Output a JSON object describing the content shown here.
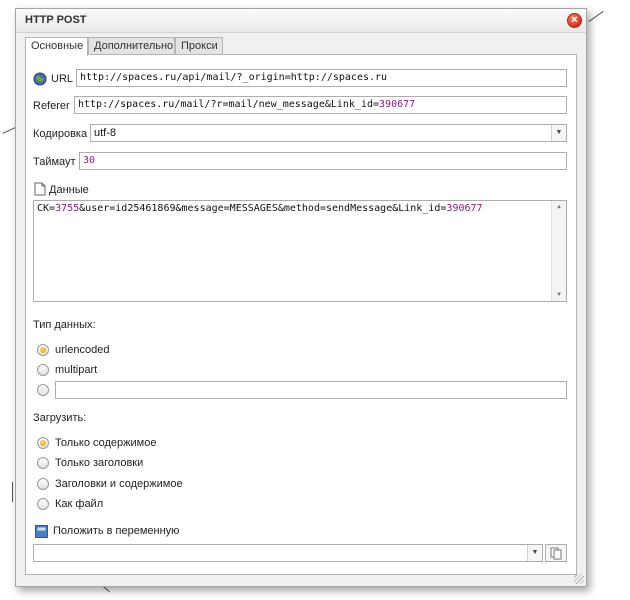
{
  "window": {
    "title": "HTTP POST",
    "close_glyph": "×"
  },
  "tabs": [
    {
      "label": "Основные",
      "active": true
    },
    {
      "label": "Дополнительно",
      "active": false
    },
    {
      "label": "Прокси",
      "active": false
    }
  ],
  "fields": {
    "url": {
      "label": "URL",
      "value": "http://spaces.ru/api/mail/?_origin=http://spaces.ru"
    },
    "referer": {
      "label": "Referer",
      "value_text": "http://spaces.ru/mail/?r=mail/new_message&Link_id=",
      "value_num": "390677"
    },
    "encoding": {
      "label": "Кодировка",
      "value": "utf-8"
    },
    "timeout": {
      "label": "Таймаут",
      "value": "30"
    },
    "data": {
      "label": "Данные",
      "value_parts": [
        "CK=",
        "3755",
        "&user=id25461869&message=MESSAGES&method=sendMessage&Link_id=",
        "390677"
      ]
    }
  },
  "data_type": {
    "label": "Тип данных:",
    "options": [
      {
        "label": "urlencoded",
        "checked": true
      },
      {
        "label": "multipart",
        "checked": false
      },
      {
        "label": "",
        "checked": false,
        "has_input": true,
        "input_value": ""
      }
    ]
  },
  "load": {
    "label": "Загрузить:",
    "options": [
      {
        "label": "Только содержимое",
        "checked": true
      },
      {
        "label": "Только заголовки",
        "checked": false
      },
      {
        "label": "Заголовки и содержимое",
        "checked": false
      },
      {
        "label": "Как файл",
        "checked": false
      }
    ]
  },
  "save_to_var": {
    "label": "Положить в переменную",
    "value": ""
  },
  "icons": {
    "url": "globe-icon",
    "data": "document-icon",
    "save": "variable-icon",
    "copy": "copy-icon",
    "dropdown": "chevron-down-icon",
    "close": "close-icon"
  },
  "colors": {
    "number_highlight": "#8b1a8b",
    "radio_checked": "#e2a010",
    "close": "#d0311f"
  }
}
